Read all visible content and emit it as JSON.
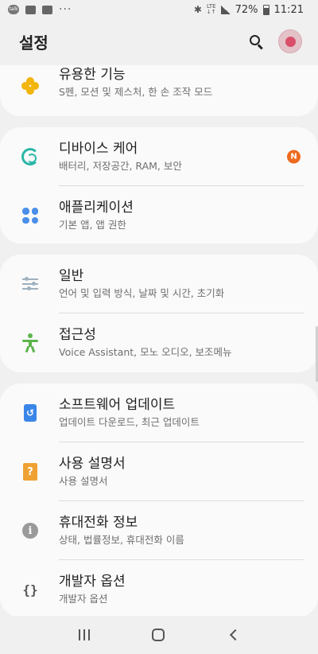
{
  "status_bar": {
    "talk_label": "talk",
    "more_dots": "···",
    "bluetooth_icon": "bluetooth-icon",
    "network": "LTE",
    "battery_percent": "72%",
    "time": "11:21"
  },
  "header": {
    "title": "설정"
  },
  "groups": [
    {
      "items": [
        {
          "title": "유용한 기능",
          "subtitle": "S펜, 모션 및 제스처, 한 손 조작 모드",
          "icon": "advanced-features-icon"
        }
      ]
    },
    {
      "items": [
        {
          "title": "디바이스 케어",
          "subtitle": "배터리, 저장공간, RAM, 보안",
          "icon": "device-care-icon",
          "badge": "N"
        },
        {
          "title": "애플리케이션",
          "subtitle": "기본 앱, 앱 권한",
          "icon": "apps-icon"
        }
      ]
    },
    {
      "items": [
        {
          "title": "일반",
          "subtitle": "언어 및 입력 방식, 날짜 및 시간, 초기화",
          "icon": "general-management-icon"
        },
        {
          "title": "접근성",
          "subtitle": "Voice Assistant, 모노 오디오, 보조메뉴",
          "icon": "accessibility-icon"
        }
      ]
    },
    {
      "items": [
        {
          "title": "소프트웨어 업데이트",
          "subtitle": "업데이트 다운로드, 최근 업데이트",
          "icon": "software-update-icon"
        },
        {
          "title": "사용 설명서",
          "subtitle": "사용 설명서",
          "icon": "user-manual-icon",
          "glyph": "?"
        },
        {
          "title": "휴대전화 정보",
          "subtitle": "상태, 법률정보, 휴대전화 이름",
          "icon": "info-icon",
          "glyph": "i"
        },
        {
          "title": "개발자 옵션",
          "subtitle": "개발자 옵션",
          "icon": "developer-options-icon",
          "glyph": "{}"
        }
      ]
    }
  ],
  "colors": {
    "background": "#f0f0f0",
    "card": "#fafafa",
    "badge": "#ee6a1f"
  }
}
